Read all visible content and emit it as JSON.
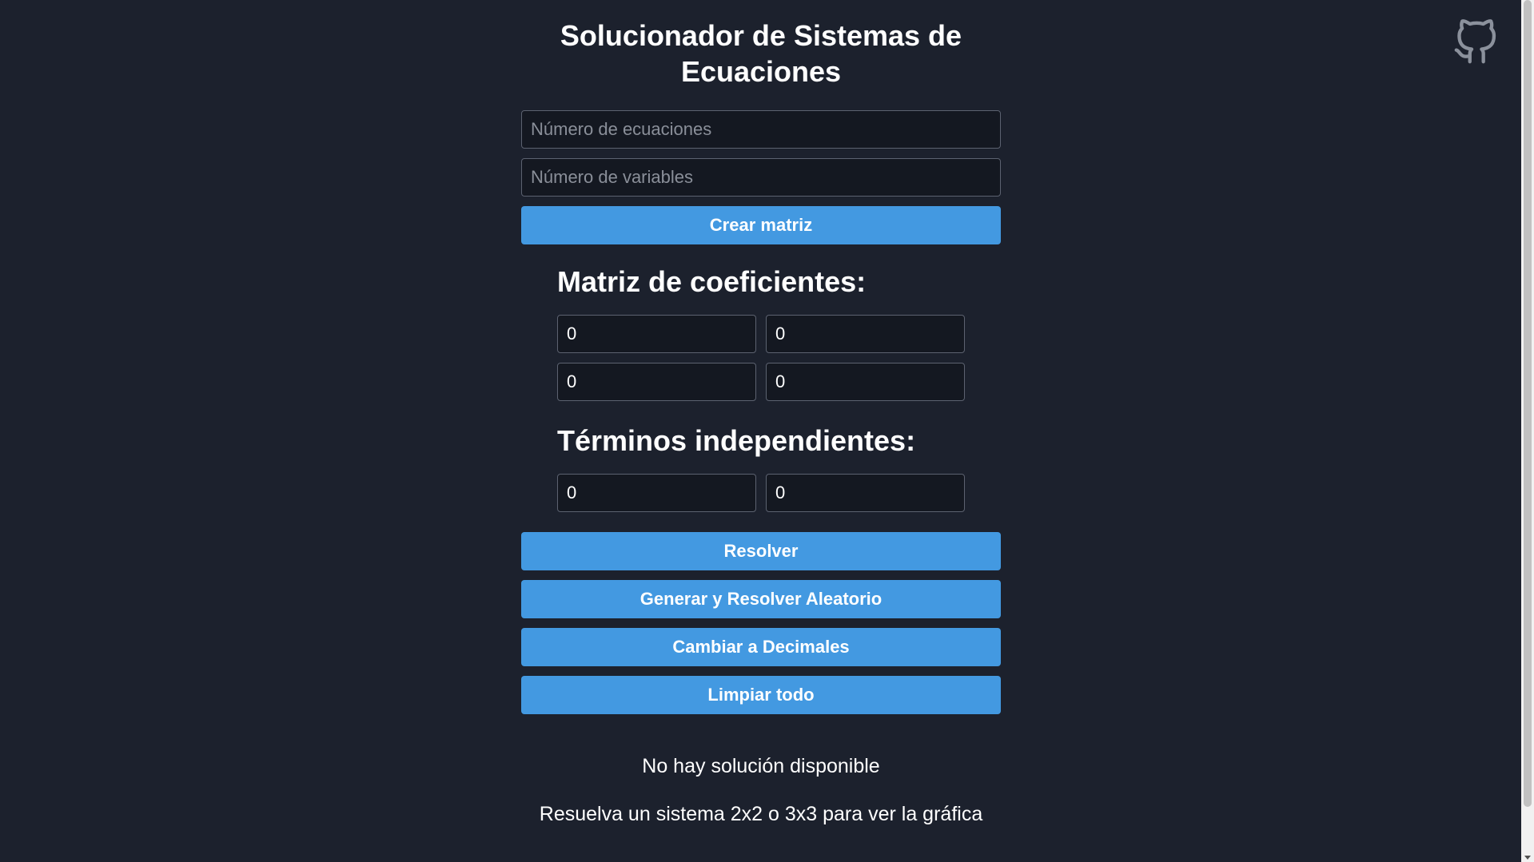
{
  "page": {
    "title": "Solucionador de Sistemas de Ecuaciones"
  },
  "inputs": {
    "num_equations_placeholder": "Número de ecuaciones",
    "num_equations_value": "",
    "num_variables_placeholder": "Número de variables",
    "num_variables_value": ""
  },
  "buttons": {
    "create_matrix": "Crear matriz",
    "solve": "Resolver",
    "random": "Generar y Resolver Aleatorio",
    "decimals": "Cambiar a Decimales",
    "clear": "Limpiar todo"
  },
  "coefficients": {
    "title": "Matriz de coeficientes:",
    "rows": [
      [
        "0",
        "0"
      ],
      [
        "0",
        "0"
      ]
    ]
  },
  "independent": {
    "title": "Términos independientes:",
    "values": [
      "0",
      "0"
    ]
  },
  "result": {
    "no_solution": "No hay solución disponible",
    "graph_hint": "Resuelva un sistema 2x2 o 3x3 para ver la gráfica"
  },
  "icons": {
    "github": "github-icon"
  },
  "colors": {
    "background": "#1c212d",
    "button": "#4399e1",
    "input_bg": "#141821",
    "input_border": "#5c6270"
  }
}
